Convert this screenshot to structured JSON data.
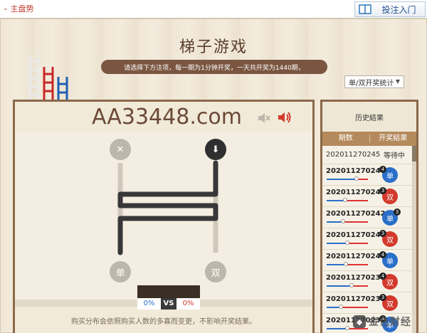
{
  "topbar": {
    "tab_main": "主盘势",
    "guide_label": "投注入门"
  },
  "title": "梯子游戏",
  "notice": "请选择下方注项，每一期为1分钟开奖，一天共开奖为1440期，",
  "stat_select": {
    "value": "单/双开奖统计"
  },
  "game": {
    "site_name": "AA33448.com",
    "left_top_symbol": "✕",
    "right_top_symbol": "⬇",
    "left_bottom_label": "单",
    "right_bottom_label": "双",
    "vs_left": "0%",
    "vs_label": "VS",
    "vs_right": "0%",
    "footer_note": "购买分布会依照购买人数的多寡而变更，不影响开奖结果。"
  },
  "history": {
    "title": "历史結果",
    "col_period": "期数",
    "col_result": "开奖結果",
    "pending": {
      "period": "202011270245",
      "status": "等待中"
    },
    "rows": [
      {
        "period": "202011270244",
        "result": "单",
        "color": "blue",
        "num": "4",
        "num_side": "left",
        "split": 0.72
      },
      {
        "period": "202011270243",
        "result": "双",
        "color": "red",
        "num": "3",
        "num_side": "left",
        "split": 0.45
      },
      {
        "period": "202011270242",
        "result": "单",
        "color": "blue",
        "num": "3",
        "num_side": "right",
        "split": 0.4
      },
      {
        "period": "202011270241",
        "result": "双",
        "color": "red",
        "num": "3",
        "num_side": "left",
        "split": 0.5
      },
      {
        "period": "202011270240",
        "result": "单",
        "color": "blue",
        "num": "4",
        "num_side": "left",
        "split": 0.46
      },
      {
        "period": "202011270239",
        "result": "双",
        "color": "red",
        "num": "4",
        "num_side": "left",
        "split": 0.6
      },
      {
        "period": "202011270238",
        "result": "双",
        "color": "red",
        "num": "3",
        "num_side": "left",
        "split": 0.35
      },
      {
        "period": "202011270237",
        "result": "单",
        "color": "blue",
        "num": "4",
        "num_side": "left",
        "split": 0.5
      }
    ]
  },
  "watermark": {
    "text": "金色财经"
  },
  "colors": {
    "accent": "#7a5640",
    "blue": "#2a6fc9",
    "red": "#d33a2c"
  }
}
